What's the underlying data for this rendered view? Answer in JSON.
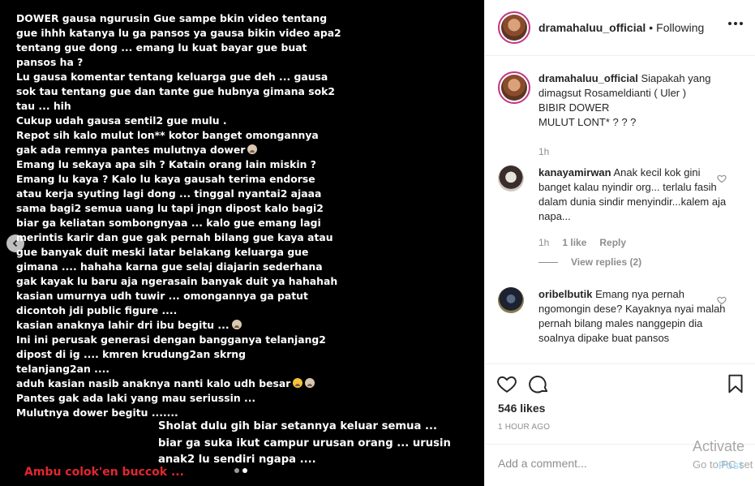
{
  "story": {
    "lines": [
      "  DOWER gausa ngurusin Gue sampe bkin video tentang",
      "gue ihhh katanya lu ga pansos ya gausa bikin video apa2",
      "tentang gue dong ... emang lu kuat bayar gue buat",
      "pansos ha ?",
      "Lu gausa komentar tentang keluarga gue deh ... gausa",
      "sok tau tentang gue dan tante gue hubnya gimana sok2",
      "tau ... hih",
      "Cukup udah gausa sentil2 gue mulu .",
      "Repot sih kalo mulut lon** kotor banget omongannya",
      "gak ada remnya pantes mulutnya dower",
      "Emang lu sekaya apa sih ? Katain orang lain miskin ?",
      "Emang lu kaya ? Kalo lu kaya gausah terima endorse",
      "atau kerja syuting lagi dong ... tinggal nyantai2 ajaaa",
      "sama bagi2 semua uang lu tapi jngn dipost kalo bagi2",
      "biar ga keliatan sombongnyaa ... kalo gue emang lagi",
      "merintis karir dan gue gak pernah bilang gue kaya atau",
      "gue banyak duit meski latar belakang keluarga gue",
      "gimana .... hahaha karna gue selaj diajarin sederhana",
      "gak kayak lu baru aja ngerasain banyak duit ya hahahah",
      "kasian umurnya udh tuwir ... omongannya ga patut",
      "dicontoh jdi public figure ....",
      "kasian anaknya lahir dri ibu begitu ...",
      "Ini ini perusak generasi dengan bangganya telanjang2",
      "dipost di ig .... kmren krudung2an skrng",
      "telanjang2an ....",
      "aduh kasian nasib anaknya nanti kalo udh besar",
      "Pantes gak ada laki yang mau seriussin ...",
      "Mulutnya dower begitu ......."
    ],
    "lines2": [
      "Sholat dulu gih biar setannya keluar semua ...",
      "biar ga suka ikut campur urusan orang ... urusin",
      "anak2 lu sendiri ngapa ...."
    ],
    "red_text": "Ambu colok'en buccok ..."
  },
  "header": {
    "username": "dramahaluu_official",
    "separator": "•",
    "following": "Following"
  },
  "caption": {
    "username": "dramahaluu_official",
    "line1": "Siapakah yang",
    "line2": "dimagsut Rosameldianti ( Uler )",
    "line3": "BIBIR DOWER",
    "line4": "MULUT LONT*  ? ? ?",
    "time": "1h"
  },
  "comments": [
    {
      "username": "kanayamirwan",
      "text": "Anak kecil kok gini banget kalau nyindir org... terlalu fasih dalam dunia sindir menyindir...kalem aja napa...",
      "time": "1h",
      "likes": "1 like",
      "reply": "Reply",
      "view_replies": "View replies (2)"
    },
    {
      "username": "oribelbutik",
      "text": "Emang nya pernah ngomongin dese? Kayaknya nyai malah pernah bilang males nanggepin dia soalnya dipake buat pansos"
    }
  ],
  "actions": {
    "likes": "546 likes",
    "time_ago": "1 HOUR AGO"
  },
  "add_comment": {
    "placeholder": "Add a comment...",
    "post": "Post"
  },
  "watermark": {
    "line1": "Activate",
    "line2": "Go to PC set"
  },
  "colors": {
    "red_text": "#e3262e",
    "story_ring": "#c13584",
    "post_disabled": "#b2dffc"
  }
}
